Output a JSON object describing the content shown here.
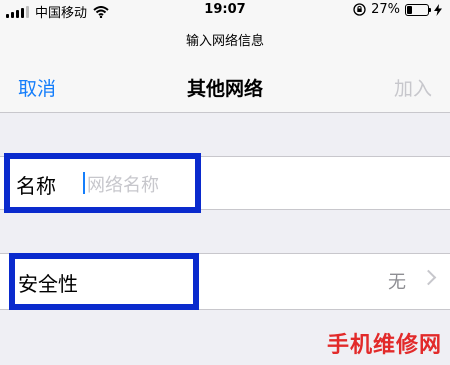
{
  "status_bar": {
    "carrier": "中国移动",
    "time": "19:07",
    "battery": "27%",
    "battery_level": 0.27
  },
  "header": {
    "subtitle": "输入网络信息",
    "cancel": "取消",
    "title": "其他网络",
    "add": "加入"
  },
  "name_row": {
    "label": "名称",
    "placeholder": "网络名称"
  },
  "security_row": {
    "label": "安全性",
    "value": "无"
  },
  "watermark": "手机维修网",
  "colors": {
    "link": "#157efb",
    "disabled": "#c7c7cc",
    "highlight_box": "#0a2acd",
    "watermark": "#e22a2a"
  },
  "icons": [
    "signal-bars-icon",
    "wifi-icon",
    "orientation-lock-icon",
    "battery-icon",
    "charging-icon",
    "chevron-right-icon"
  ]
}
